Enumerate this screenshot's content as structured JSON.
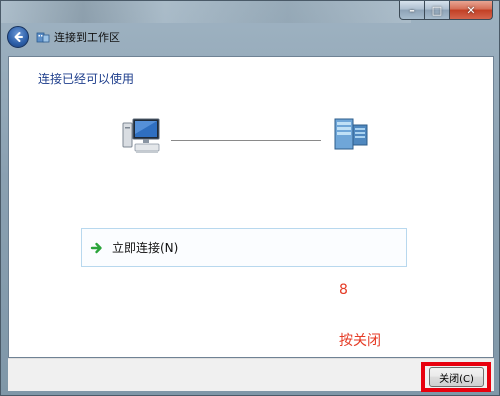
{
  "window": {
    "title": "连接到工作区",
    "caption": {
      "minimize": "–",
      "maximize": "□",
      "close": "✕"
    },
    "back_icon": "back-arrow-icon"
  },
  "content": {
    "heading": "连接已经可以使用",
    "option": {
      "label": "立即连接(N)",
      "icon": "green-arrow-icon"
    }
  },
  "annotations": {
    "step_number": "8",
    "instruction": "按关闭"
  },
  "footer": {
    "close_label": "关闭(C)"
  },
  "colors": {
    "heading": "#1e3e8c",
    "annotation": "#e53a24",
    "highlight": "#e8000e",
    "option_border": "#b8d8ee"
  }
}
